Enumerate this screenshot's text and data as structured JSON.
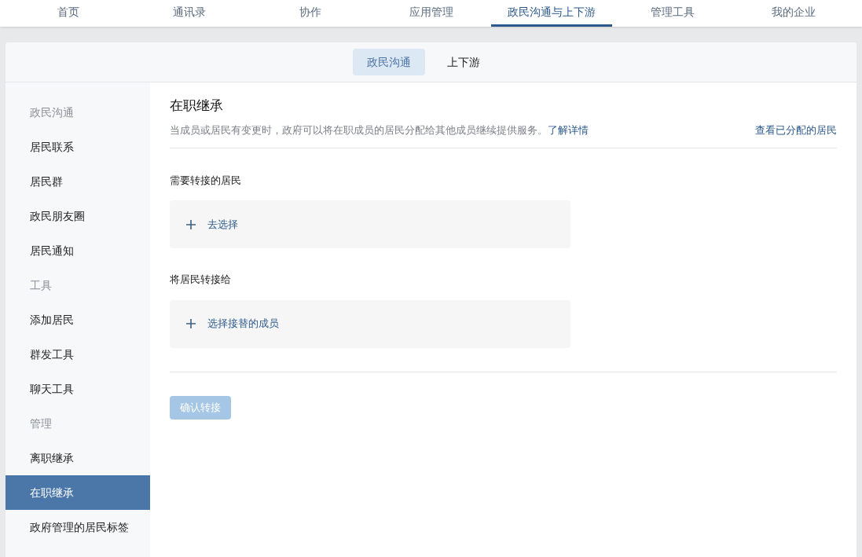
{
  "top_nav": [
    {
      "label": "首页",
      "selected": false
    },
    {
      "label": "通讯录",
      "selected": false
    },
    {
      "label": "协作",
      "selected": false
    },
    {
      "label": "应用管理",
      "selected": false
    },
    {
      "label": "政民沟通与上下游",
      "selected": true
    },
    {
      "label": "管理工具",
      "selected": false
    },
    {
      "label": "我的企业",
      "selected": false
    }
  ],
  "sub_tabs": [
    {
      "label": "政民沟通",
      "selected": true
    },
    {
      "label": "上下游",
      "selected": false
    }
  ],
  "sidebar": {
    "sections": [
      {
        "title": "政民沟通",
        "items": [
          {
            "label": "居民联系",
            "selected": false
          },
          {
            "label": "居民群",
            "selected": false
          },
          {
            "label": "政民朋友圈",
            "selected": false
          },
          {
            "label": "居民通知",
            "selected": false
          }
        ]
      },
      {
        "title": "工具",
        "items": [
          {
            "label": "添加居民",
            "selected": false
          },
          {
            "label": "群发工具",
            "selected": false
          },
          {
            "label": "聊天工具",
            "selected": false
          }
        ]
      },
      {
        "title": "管理",
        "items": [
          {
            "label": "离职继承",
            "selected": false
          },
          {
            "label": "在职继承",
            "selected": true
          },
          {
            "label": "政府管理的居民标签",
            "selected": false
          }
        ]
      }
    ]
  },
  "main": {
    "title": "在职继承",
    "description": "当成员或居民有变更时，政府可以将在职成员的居民分配给其他成员继续提供服务。",
    "learn_more": "了解详情",
    "view_assigned": "查看已分配的居民",
    "fields": [
      {
        "label": "需要转接的居民",
        "action": "去选择"
      },
      {
        "label": "将居民转接给",
        "action": "选择接替的成员"
      }
    ],
    "confirm_button": {
      "label": "确认转接",
      "disabled": true
    }
  }
}
